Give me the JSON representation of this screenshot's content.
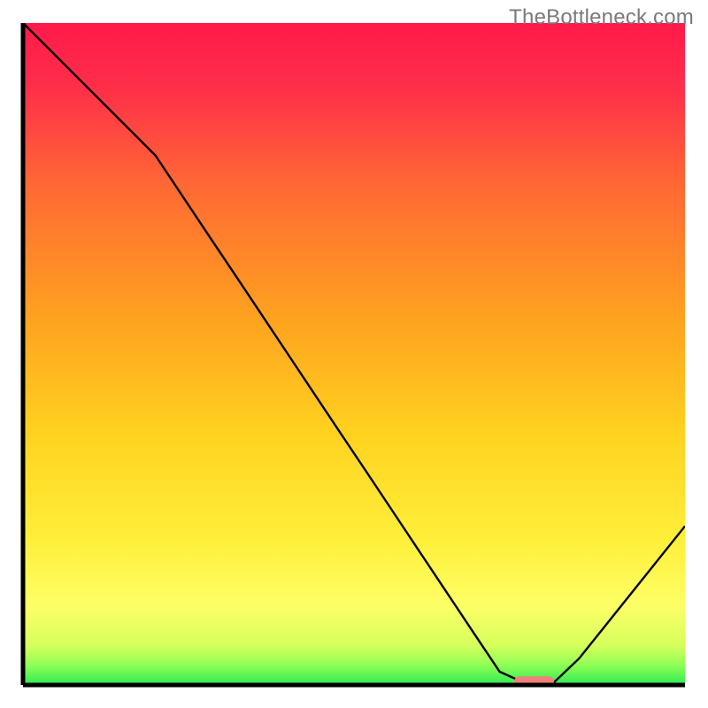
{
  "watermark": "TheBottleneck.com",
  "chart_data": {
    "type": "line",
    "title": "",
    "xlabel": "",
    "ylabel": "",
    "xlim": [
      0,
      1000
    ],
    "ylim": [
      0,
      1000
    ],
    "x": [
      0,
      40,
      80,
      120,
      160,
      200,
      240,
      280,
      320,
      360,
      400,
      440,
      480,
      520,
      560,
      600,
      640,
      680,
      720,
      760,
      800,
      840,
      880,
      920,
      960,
      1000
    ],
    "values": [
      1000,
      960,
      920,
      880,
      840,
      800,
      740,
      680,
      620,
      560,
      500,
      440,
      380,
      320,
      260,
      200,
      140,
      80,
      20,
      2,
      2,
      40,
      90,
      140,
      190,
      240
    ],
    "trough_marker": {
      "x_start": 742,
      "x_end": 802,
      "y": 5
    },
    "grid": false,
    "legend": false
  },
  "colors": {
    "axis": "#000000",
    "curve": "#000000",
    "marker": "#f27f7a",
    "gradient_top": "#ff1744",
    "gradient_mid1": "#ff8a00",
    "gradient_mid2": "#ffd600",
    "gradient_mid3": "#ffff66",
    "gradient_bottom": "#2eea55"
  }
}
